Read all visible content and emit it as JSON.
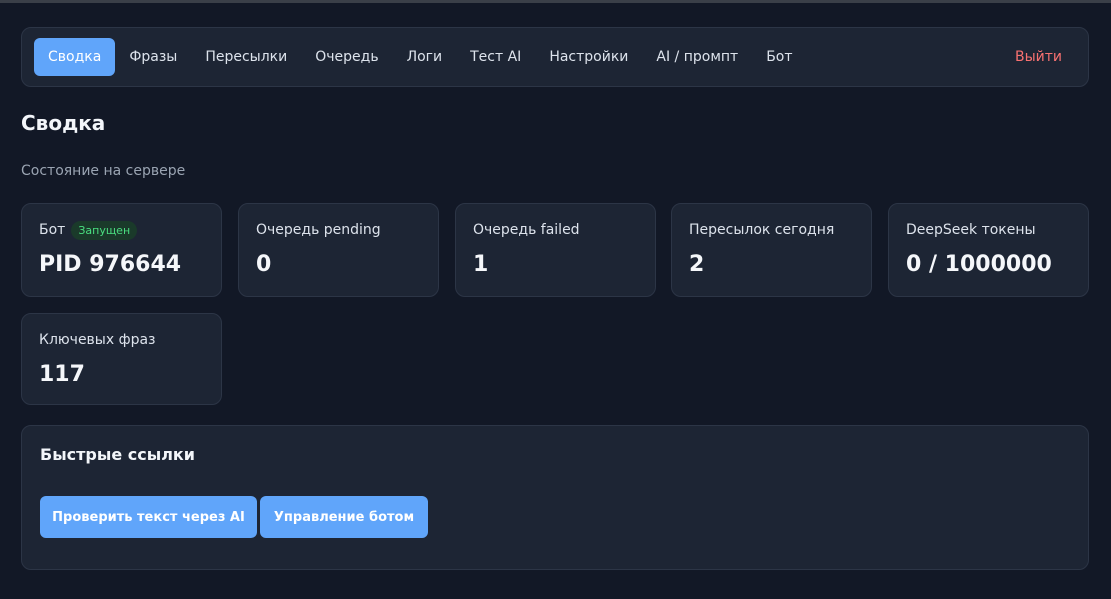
{
  "nav": {
    "items": [
      "Сводка",
      "Фразы",
      "Пересылки",
      "Очередь",
      "Логи",
      "Тест AI",
      "Настройки",
      "AI / промпт",
      "Бот"
    ],
    "active_index": 0,
    "logout": "Выйти"
  },
  "page": {
    "title": "Сводка",
    "subtitle": "Состояние на сервере"
  },
  "cards": [
    {
      "label": "Бот",
      "badge": "Запущен",
      "value": "PID 976644"
    },
    {
      "label": "Очередь pending",
      "value": "0"
    },
    {
      "label": "Очередь failed",
      "value": "1"
    },
    {
      "label": "Пересылок сегодня",
      "value": "2"
    },
    {
      "label": "DeepSeek токены",
      "value": "0 / 1000000"
    },
    {
      "label": "Ключевых фраз",
      "value": "117"
    }
  ],
  "quick_links": {
    "title": "Быстрые ссылки",
    "buttons": [
      "Проверить текст через AI",
      "Управление ботом"
    ]
  },
  "colors": {
    "background": "#121826",
    "panel": "#1d2534",
    "accent": "#60a5fa",
    "logout": "#f87171",
    "badge_text": "#4ade80"
  }
}
